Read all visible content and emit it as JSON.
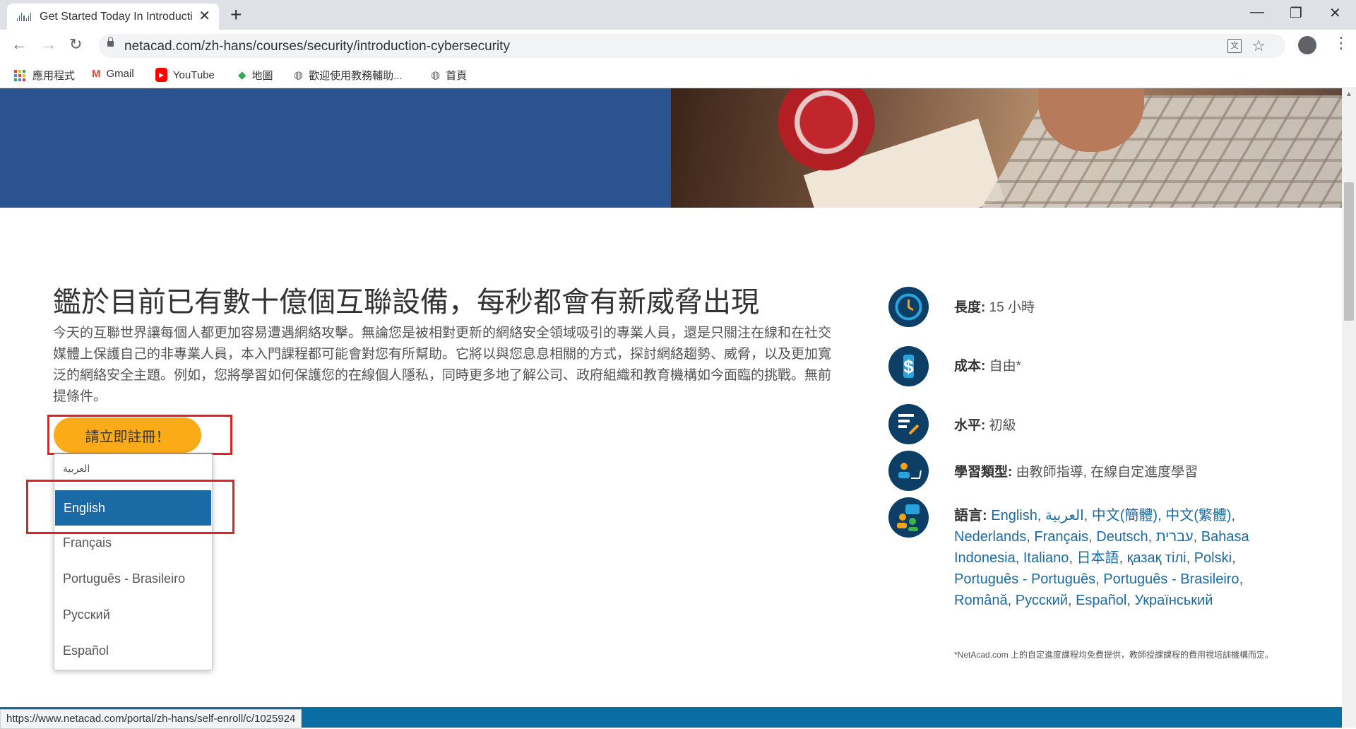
{
  "browser": {
    "tab_title": "Get Started Today In Introducti",
    "url": "netacad.com/zh-hans/courses/security/introduction-cybersecurity",
    "bookmarks": [
      "應用程式",
      "Gmail",
      "YouTube",
      "地圖",
      "歡迎使用教務輔助...",
      "首頁"
    ]
  },
  "course": {
    "headline": "鑑於目前已有數十億個互聯設備，每秒都會有新威脅出現",
    "description": "今天的互聯世界讓每個人都更加容易遭遇網絡攻擊。無論您是被相對更新的網絡安全領域吸引的專業人員，還是只關注在線和在社交媒體上保護自己的非專業人員，本入門課程都可能會對您有所幫助。它將以與您息息相關的方式，探討網絡趨勢、威脅，以及更加寬泛的網絡安全主題。例如，您將學習如何保護您的在線個人隱私，同時更多地了解公司、政府組織和教育機構如今面臨的挑戰。無前提條件。",
    "register_label": "請立即註冊！"
  },
  "language_dropdown": {
    "options": [
      "العربية",
      "English",
      "Français",
      "Português - Brasileiro",
      "Русский",
      "Español"
    ],
    "selected": "English"
  },
  "info": {
    "length_label": "長度:",
    "length_value": "15 小時",
    "cost_label": "成本:",
    "cost_value": "自由*",
    "level_label": "水平:",
    "level_value": "初級",
    "type_label": "學習類型:",
    "type_value": "由教師指導, 在線自定進度學習",
    "languages_label": "語言:",
    "languages": [
      "English",
      "العربية",
      "中文(簡體)",
      "中文(繁體)",
      "Nederlands",
      "Français",
      "Deutsch",
      "עברית",
      "Bahasa Indonesia",
      "Italiano",
      "日本語",
      "қазақ тілі",
      "Polski",
      "Português - Português",
      "Português - Brasileiro",
      "Română",
      "Русский",
      "Español",
      "Український"
    ],
    "note": "*NetAcad.com 上的自定進度課程均免費提供，教師授課課程的費用視培訓機構而定。"
  },
  "status_url": "https://www.netacad.com/portal/zh-hans/self-enroll/c/1025924",
  "colors": {
    "hero_blue": "#2b5390",
    "button_orange": "#fbab18",
    "dropdown_selected": "#1a6aa6",
    "link_blue": "#1a6aa6",
    "icon_navy": "#0d3e66",
    "highlight_red": "#e32121",
    "footer_blue": "#0a6ea3"
  }
}
